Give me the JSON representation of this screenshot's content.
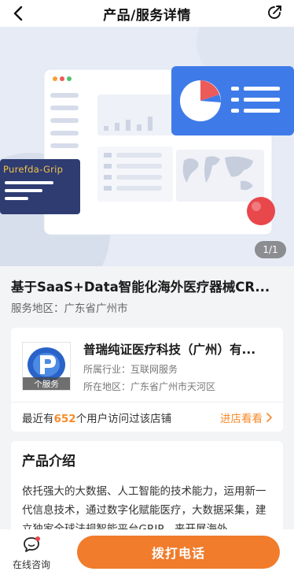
{
  "header": {
    "title": "产品/服务详情",
    "back_icon": "chevron-left-icon",
    "share_icon": "share-icon"
  },
  "banner": {
    "brand_label": "Purefda-Grip",
    "counter": "1/1",
    "colors": {
      "background": "#e6ebf5",
      "blue_panel": "#3f7be8",
      "navy_card": "#2e3c72",
      "red_dot": "#e8474c"
    }
  },
  "product": {
    "title": "基于SaaS+Data智能化海外医疗器械CR...",
    "region": "服务地区：广东省广州市"
  },
  "shop": {
    "logo_tag": "个服务",
    "name": "普瑞纯证医疗科技（广州）有...",
    "industry": "所属行业：互联网服务",
    "location": "所在地区：广东省广州市天河区",
    "visit_prefix": "最近有",
    "visit_count": "652",
    "visit_suffix": "个用户访问过该店铺",
    "enter_label": "进店看看"
  },
  "intro": {
    "heading": "产品介绍",
    "body": "依托强大的大数据、人工智能的技术能力，运用新一代信息技术，通过数字化赋能医疗，大数据采集，建立独家全球法规智能平台GRIP，来开展海外"
  },
  "bottom": {
    "consult_label": "在线咨询",
    "call_label": "拨打电话",
    "accent": "#f07c2c"
  }
}
